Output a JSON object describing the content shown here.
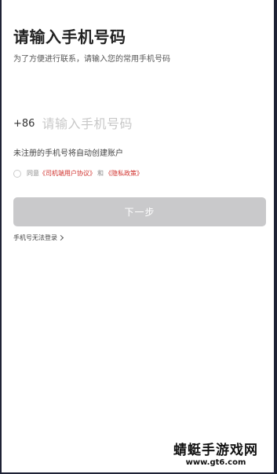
{
  "login": {
    "title": "请输入手机号码",
    "subtitle": "为了方便进行联系，请输入您的常用手机号码",
    "country_code": "+86",
    "phone_placeholder": "请输入手机号码",
    "auto_register_hint": "未注册的手机号将自动创建账户",
    "agreement": {
      "prefix": "同意",
      "user_agreement": "《司机端用户协议》",
      "conjunction": "和",
      "privacy_policy": "《隐私政策》"
    },
    "next_button": "下一步",
    "cant_login": "手机号无法登录"
  },
  "watermark": {
    "title": "蜻蜓手游戏网",
    "url": "www.gt6.com"
  },
  "colors": {
    "link_red": "#d0312d",
    "button_disabled": "#c9c9cb",
    "frame_border": "#1e2235"
  },
  "icons": {
    "agree_checkbox": "circle-outline",
    "cant_login_arrow": "chevron-right-icon"
  }
}
